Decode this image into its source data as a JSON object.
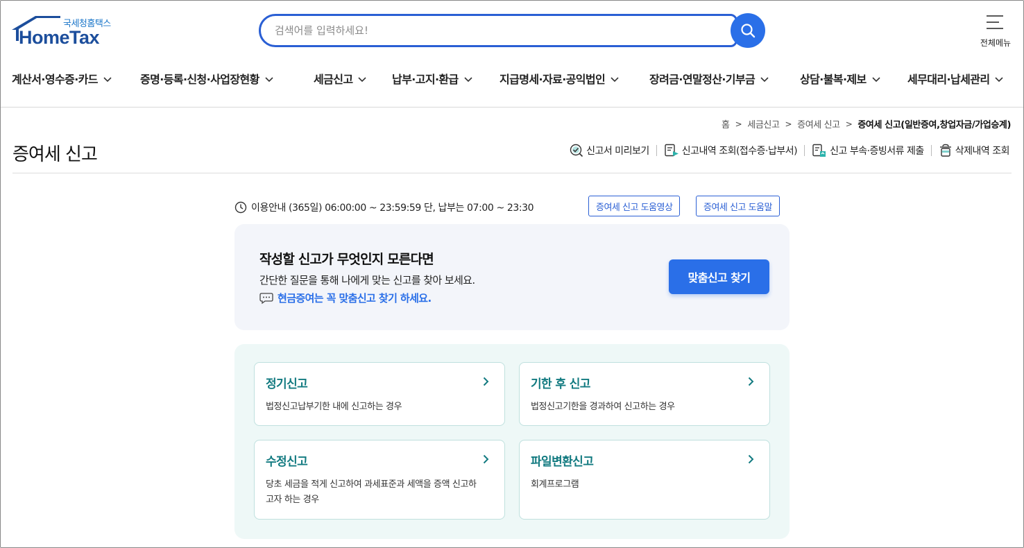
{
  "header": {
    "logo_kr": "국세청홈택스",
    "logo_en": "HomeTax",
    "search_placeholder": "검색어를 입력하세요!",
    "all_menu_label": "전체메뉴"
  },
  "nav": {
    "items": [
      {
        "label": "계산서·영수증·카드"
      },
      {
        "label": "증명·등록·신청·사업장현황"
      },
      {
        "label": "세금신고"
      },
      {
        "label": "납부·고지·환급"
      },
      {
        "label": "지급명세·자료·공익법인"
      },
      {
        "label": "장려금·연말정산·기부금"
      },
      {
        "label": "상담·불복·제보"
      },
      {
        "label": "세무대리·납세관리"
      }
    ]
  },
  "breadcrumb": [
    "홈",
    "세금신고",
    "증여세 신고",
    "증여세 신고(일반증여,창업자금/가업승계)"
  ],
  "page": {
    "title": "증여세 신고",
    "actions": [
      {
        "label": "신고서 미리보기",
        "icon": "preview-check-icon"
      },
      {
        "label": "신고내역 조회(접수증·납부서)",
        "icon": "document-search-icon"
      },
      {
        "label": "신고 부속·증빙서류 제출",
        "icon": "document-upload-icon"
      },
      {
        "label": "삭제내역 조회",
        "icon": "trash-icon"
      }
    ]
  },
  "info": {
    "hours": "이용안내 (365일) 06:00:00 ~ 23:59:59 단, 납부는 07:00 ~ 23:30",
    "help_video": "증여세 신고 도움영상",
    "help_text": "증여세 신고 도움말"
  },
  "finder": {
    "title": "작성할 신고가 무엇인지 모른다면",
    "desc": "간단한 질문을 통해 나에게 맞는 신고를 찾아 보세요.",
    "link": "현금증여는 꼭 맞춤신고 찾기 하세요.",
    "button": "맞춤신고 찾기"
  },
  "cards": [
    {
      "title": "정기신고",
      "desc": "법정신고납부기한 내에 신고하는 경우"
    },
    {
      "title": "기한 후 신고",
      "desc": "법정신고기한을 경과하여 신고하는 경우"
    },
    {
      "title": "수정신고",
      "desc": "당초 세금을 적게 신고하여 과세표준과 세액을 증액 신고하고자 하는 경우"
    },
    {
      "title": "파일변환신고",
      "desc": "회계프로그램"
    }
  ],
  "colors": {
    "primary_blue": "#2a6fe8",
    "logo_blue": "#1c4e9c",
    "teal_title": "#127a80",
    "finder_bg": "#f3f5fa",
    "cards_bg": "#eef8f7"
  }
}
